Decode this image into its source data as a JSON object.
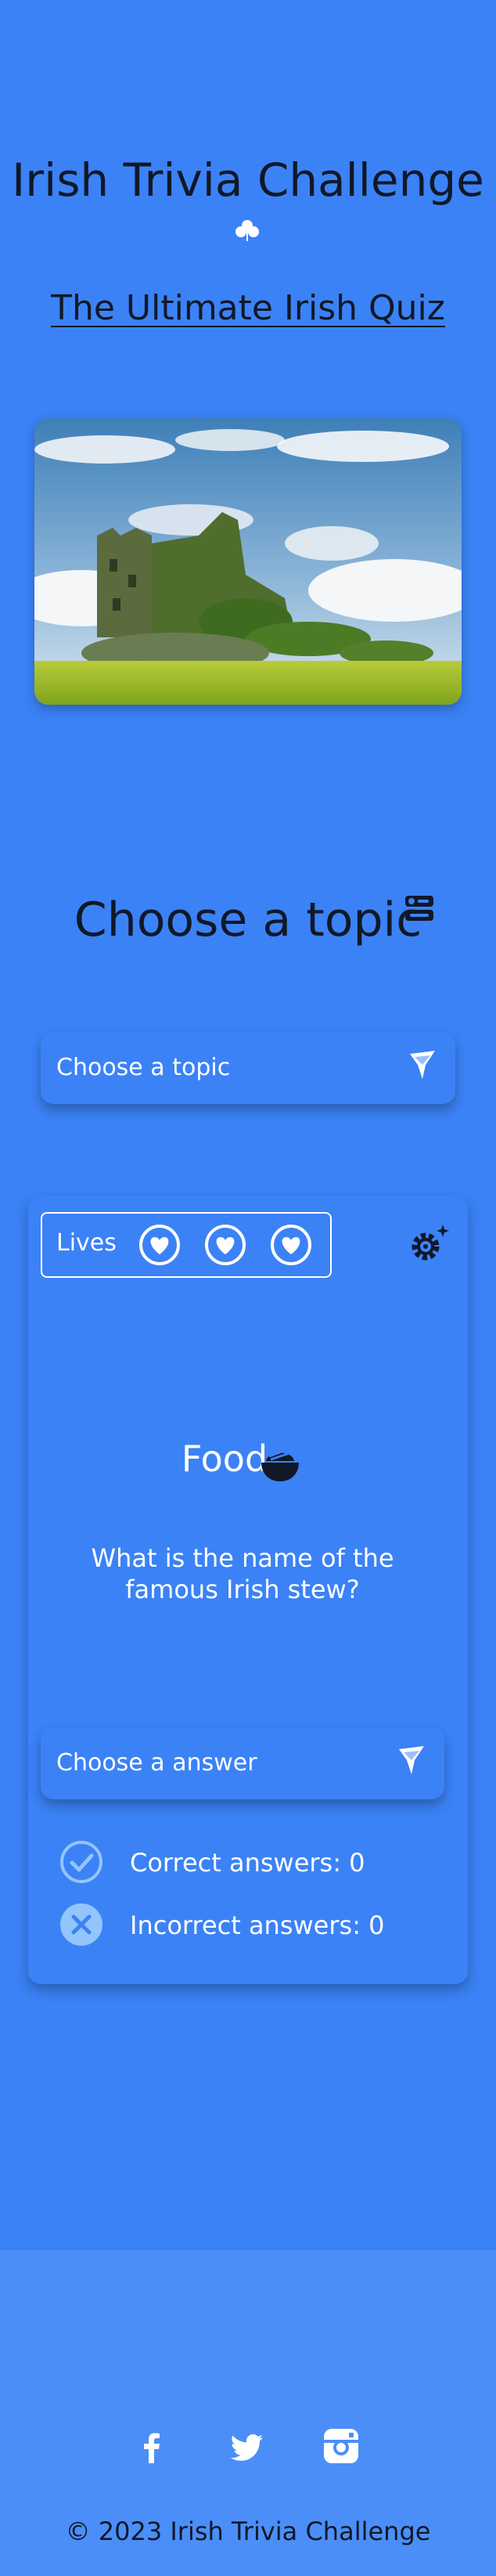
{
  "header": {
    "title": "Irish Trivia Challenge",
    "subtitle": "The Ultimate Irish Quiz",
    "title_icon": "clover-icon"
  },
  "hero": {
    "image": "castle-ruin-photo",
    "alt": "Irish castle ruin"
  },
  "topic_section": {
    "heading": "Choose a topic",
    "heading_icon": "quiz-icon",
    "dropdown_value": "Choose a topic"
  },
  "quiz": {
    "lives_label": "Lives",
    "lives": 3,
    "category": "Food",
    "category_icon": "bowl-icon",
    "question": "What is the name of the famous Irish stew?",
    "answer_dropdown_value": "Choose a answer",
    "correct_label": "Correct answers: 0",
    "incorrect_label": "Incorrect answers: 0"
  },
  "footer": {
    "social": [
      "facebook-icon",
      "twitter-icon",
      "instagram-icon"
    ],
    "copyright": "© 2023 Irish Trivia Challenge"
  },
  "colors": {
    "background": "#3b82f6",
    "footer": "#4b8ef8",
    "text_dark": "#111827"
  }
}
